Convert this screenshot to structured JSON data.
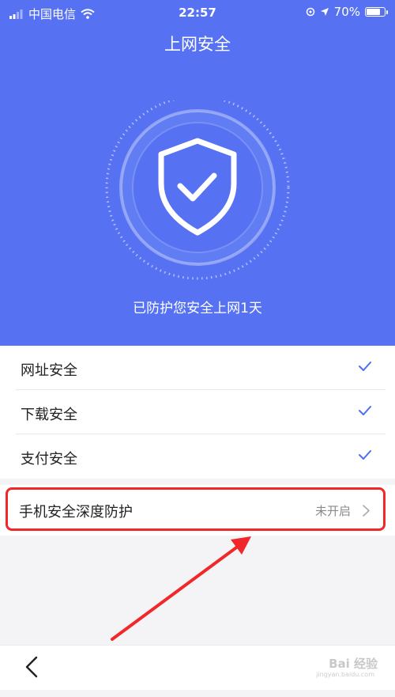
{
  "status_bar": {
    "carrier": "中国电信",
    "time": "22:57",
    "battery": "70%",
    "battery_level": 0.7
  },
  "header": {
    "title": "上网安全",
    "protect_text": "已防护您安全上网1天"
  },
  "list": {
    "items": [
      {
        "label": "网址安全",
        "checked": true
      },
      {
        "label": "下载安全",
        "checked": true
      },
      {
        "label": "支付安全",
        "checked": true
      }
    ]
  },
  "deep_protection": {
    "label": "手机安全深度防护",
    "status": "未开启"
  },
  "watermark": {
    "text": "Bai 经验",
    "url": "jingyan.baidu.com"
  },
  "colors": {
    "primary": "#5672f2",
    "check": "#4b6ef5",
    "highlight": "#f0282a"
  },
  "icons": {
    "shield": "shield-check-icon",
    "back": "chevron-left-icon",
    "row_arrow": "chevron-right-icon",
    "check": "check-icon",
    "wifi": "wifi-icon",
    "location": "location-arrow-icon"
  }
}
